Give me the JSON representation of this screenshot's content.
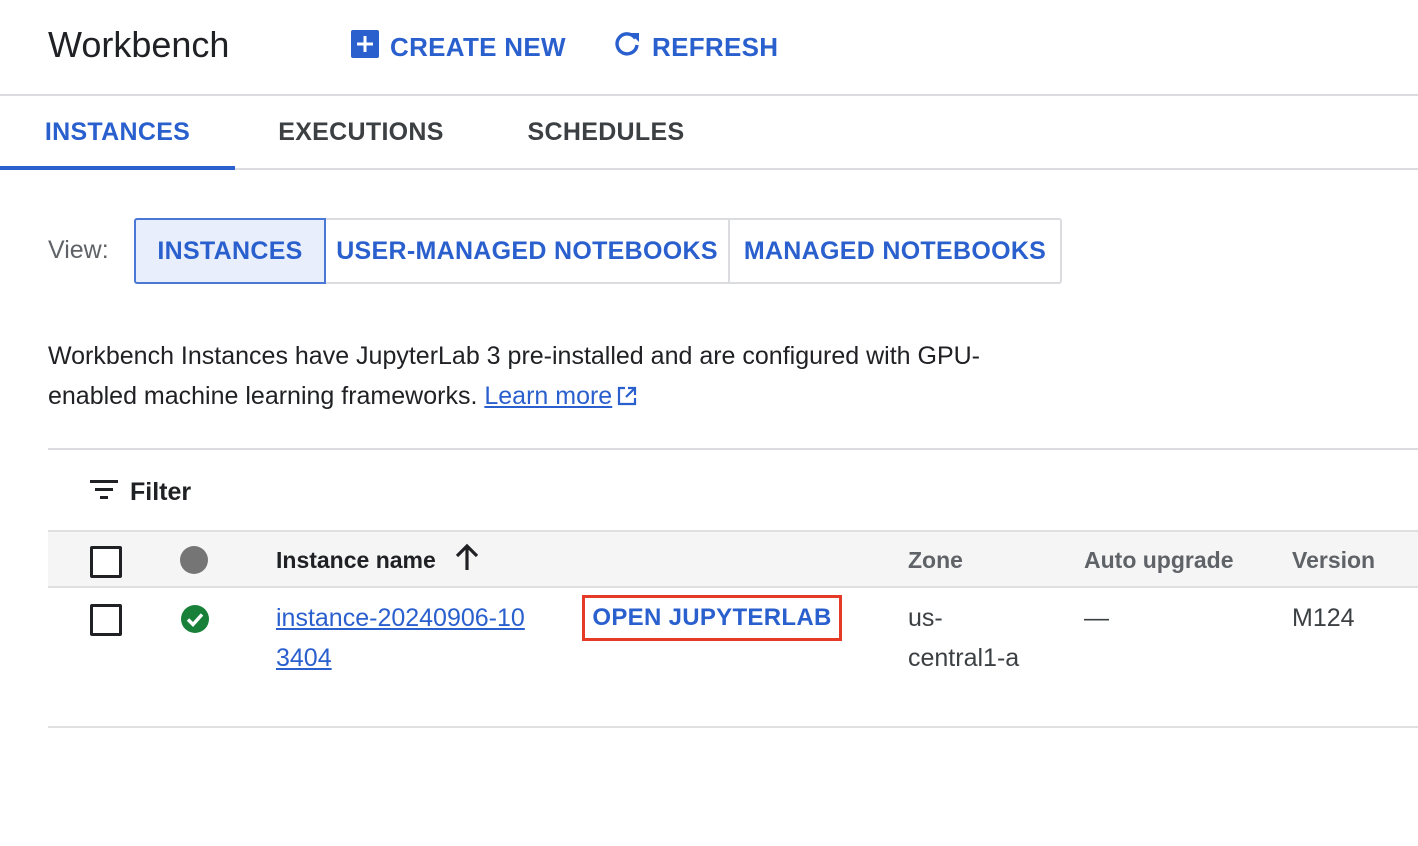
{
  "header": {
    "title": "Workbench",
    "create_label": "CREATE NEW",
    "refresh_label": "REFRESH"
  },
  "tabs": [
    {
      "label": "INSTANCES",
      "active": true
    },
    {
      "label": "EXECUTIONS",
      "active": false
    },
    {
      "label": "SCHEDULES",
      "active": false
    }
  ],
  "view": {
    "label": "View:",
    "options": [
      {
        "label": "INSTANCES",
        "selected": true
      },
      {
        "label": "USER-MANAGED NOTEBOOKS",
        "selected": false
      },
      {
        "label": "MANAGED NOTEBOOKS",
        "selected": false
      }
    ]
  },
  "description": {
    "text": "Workbench Instances have JupyterLab 3 pre-installed and are configured with GPU-enabled machine learning frameworks.",
    "link_label": "Learn more"
  },
  "filter": {
    "label": "Filter"
  },
  "table": {
    "columns": {
      "name": "Instance name",
      "zone": "Zone",
      "auto_upgrade": "Auto upgrade",
      "version": "Version"
    },
    "rows": [
      {
        "name": "instance-20240906-103404",
        "action_label": "OPEN JUPYTERLAB",
        "zone": "us-central1-a",
        "auto_upgrade": "—",
        "version": "M124",
        "status": "running"
      }
    ]
  },
  "colors": {
    "accent": "#2a5fce",
    "status_ok": "#188038",
    "highlight": "#e53a26"
  }
}
